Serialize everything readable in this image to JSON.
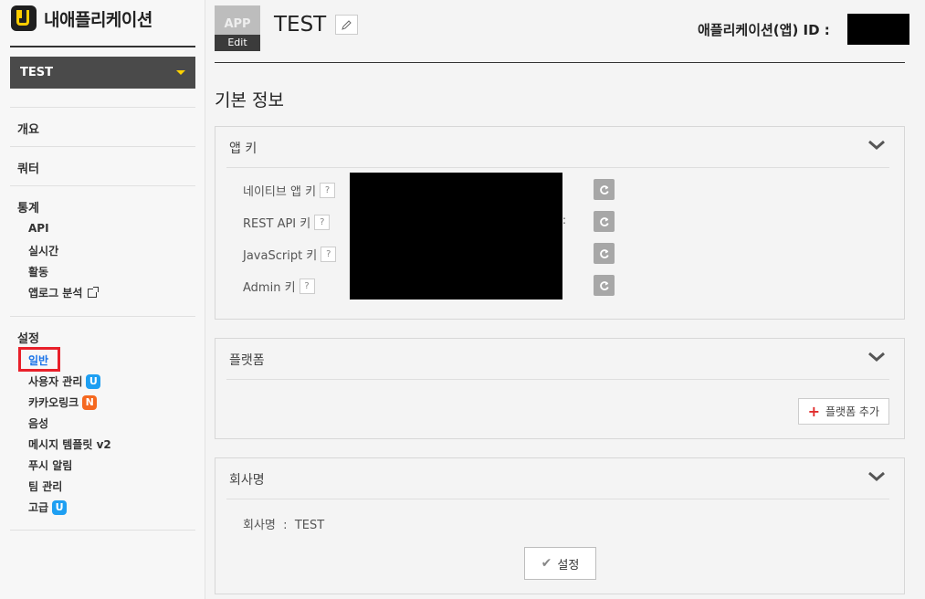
{
  "brand": {
    "title": "내애플리케이션"
  },
  "app_selector": {
    "selected": "TEST"
  },
  "sidebar": {
    "overview": "개요",
    "quarter": "쿼터",
    "stats": {
      "header": "통계",
      "items": [
        "API",
        "실시간",
        "활동",
        "앱로그 분석"
      ]
    },
    "settings": {
      "header": "설정",
      "items": [
        {
          "label": "일반"
        },
        {
          "label": "사용자 관리",
          "badge": "U"
        },
        {
          "label": "카카오링크",
          "badge": "N"
        },
        {
          "label": "음성"
        },
        {
          "label": "메시지 템플릿 v2"
        },
        {
          "label": "푸시 알림"
        },
        {
          "label": "팀 관리"
        },
        {
          "label": "고급",
          "badge": "U"
        }
      ]
    }
  },
  "header": {
    "thumb_placeholder": "APP",
    "thumb_edit": "Edit",
    "app_name": "TEST",
    "app_id_label": "애플리케이션(앱) ID :"
  },
  "section_title": "기본 정보",
  "app_keys": {
    "title": "앱 키",
    "help": "?",
    "rows": [
      {
        "label": "네이티브 앱 키"
      },
      {
        "label": "REST API 키"
      },
      {
        "label": "JavaScript 키"
      },
      {
        "label": "Admin 키"
      }
    ],
    "masked_fragment": ":"
  },
  "platform": {
    "title": "플랫폼",
    "add_label": "플랫폼 추가"
  },
  "company": {
    "title": "회사명",
    "label": "회사명",
    "separator": ":",
    "value": "TEST",
    "set_label": "설정"
  },
  "colors": {
    "active_link": "#1a73e8",
    "badge_blue": "#1e9ff2",
    "badge_orange": "#f5681f",
    "highlight": "#e8202a",
    "brand_yellow": "#ffcd00"
  }
}
